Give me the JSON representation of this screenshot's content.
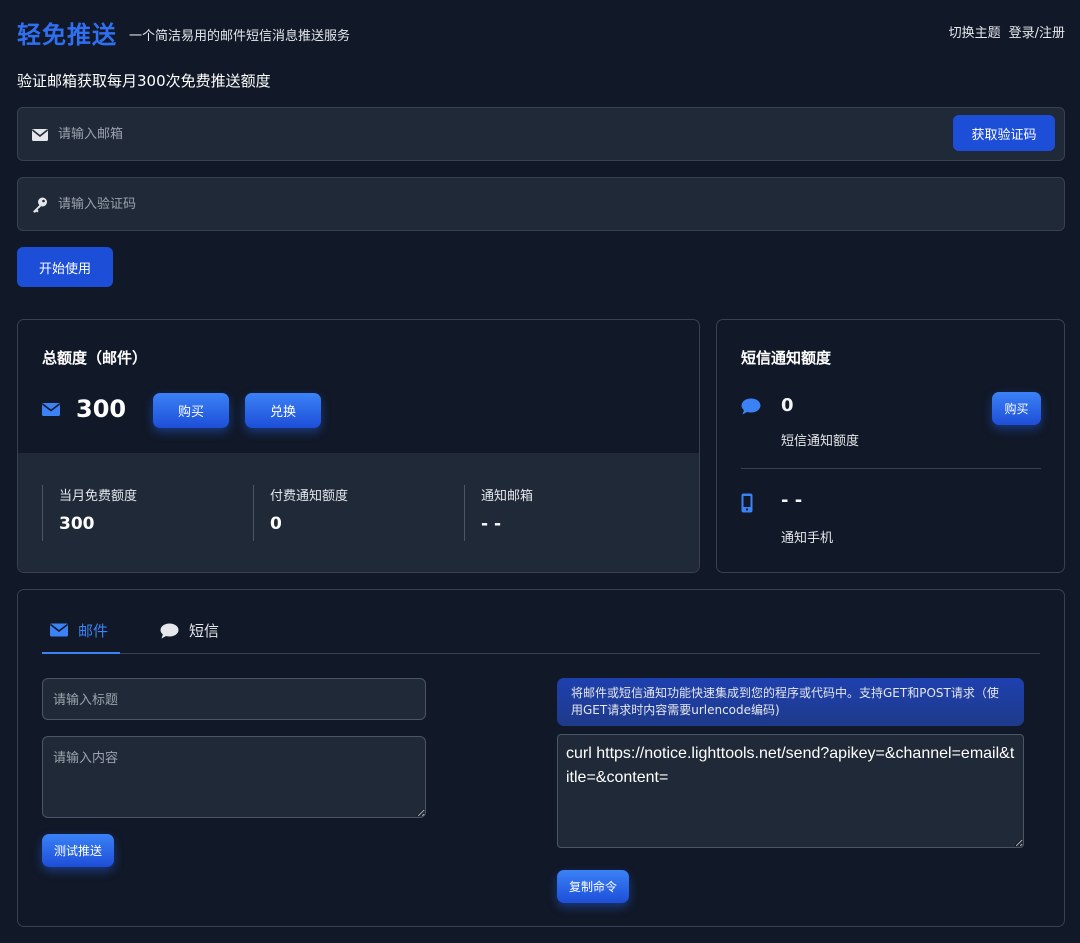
{
  "header": {
    "brand": "轻免推送",
    "tagline": "一个简洁易用的邮件短信消息推送服务",
    "nav": {
      "theme_label": "切换主题",
      "login_label": "登录/注册"
    }
  },
  "headline": "验证邮箱获取每月300次免费推送额度",
  "form": {
    "email_placeholder": "请输入邮箱",
    "get_code_label": "获取验证码",
    "code_placeholder": "请输入验证码",
    "start_label": "开始使用"
  },
  "email_quota": {
    "title": "总额度（邮件）",
    "total": "300",
    "buy_label": "购买",
    "redeem_label": "兑换",
    "stats": [
      {
        "label": "当月免费额度",
        "value": "300"
      },
      {
        "label": "付费通知额度",
        "value": "0"
      },
      {
        "label": "通知邮箱",
        "value": "- -"
      }
    ]
  },
  "sms_quota": {
    "title": "短信通知额度",
    "count": "0",
    "count_label": "短信通知额度",
    "buy_label": "购买",
    "phone": "- -",
    "phone_label": "通知手机"
  },
  "tabs": [
    {
      "label": "邮件",
      "active": true
    },
    {
      "label": "短信",
      "active": false
    }
  ],
  "test_form": {
    "title_placeholder": "请输入标题",
    "content_placeholder": "请输入内容",
    "send_label": "测试推送"
  },
  "api": {
    "info": "将邮件或短信通知功能快速集成到您的程序或代码中。支持GET和POST请求（使用GET请求时内容需要urlencode编码)",
    "command": "curl https://notice.lighttools.net/send?apikey=&channel=email&title=&content=",
    "copy_label": "复制命令"
  },
  "colors": {
    "background": "#111827",
    "panel": "#1f2937",
    "accent": "#2f6ff0",
    "button": "#1d4ed8",
    "border": "#374151"
  }
}
